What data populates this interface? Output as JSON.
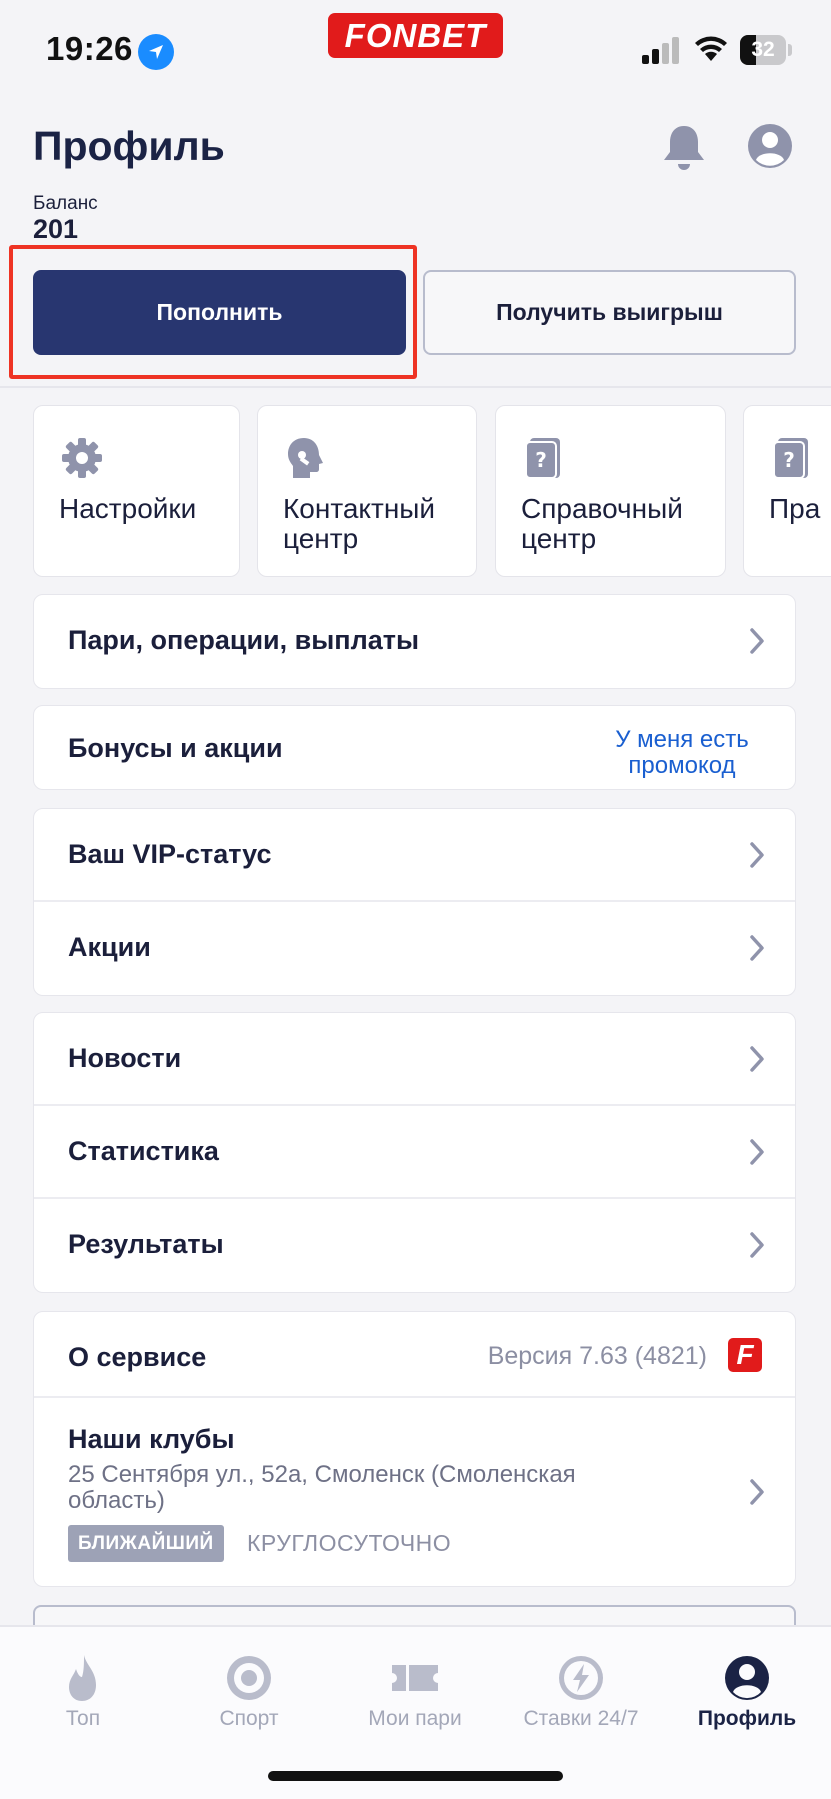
{
  "status_bar": {
    "time": "19:26",
    "brand": "FONBET",
    "battery": "32"
  },
  "header": {
    "title": "Профиль",
    "balance_label": "Баланс",
    "balance_value": "201"
  },
  "actions": {
    "deposit": "Пополнить",
    "withdraw": "Получить выигрыш"
  },
  "tiles": [
    {
      "label": "Настройки",
      "icon": "gear-icon"
    },
    {
      "label": "Контактный центр",
      "icon": "support-head-icon"
    },
    {
      "label": "Справочный центр",
      "icon": "help-book-icon"
    },
    {
      "label": "Пра",
      "icon": "rules-book-icon"
    }
  ],
  "menu": {
    "bets": "Пари, операции, выплаты",
    "bonuses": "Бонусы и акции",
    "promo_link": "У меня есть промокод",
    "vip": "Ваш VIP-статус",
    "promos": "Акции",
    "news": "Новости",
    "stats": "Статистика",
    "results": "Результаты",
    "about": "О сервисе",
    "version": "Версия 7.63 (4821)",
    "f_logo": "F"
  },
  "clubs": {
    "title": "Наши клубы",
    "address": "25 Сентября ул., 52а, Смоленск (Смоленская область)",
    "badge": "БЛИЖАЙШИЙ",
    "hours": "КРУГЛОСУТОЧНО"
  },
  "tabbar": [
    {
      "label": "Топ",
      "icon": "flame-icon"
    },
    {
      "label": "Спорт",
      "icon": "target-icon"
    },
    {
      "label": "Мои пари",
      "icon": "ticket-icon"
    },
    {
      "label": "Ставки 24/7",
      "icon": "lightning-icon"
    },
    {
      "label": "Профиль",
      "icon": "profile-icon",
      "active": true
    }
  ],
  "colors": {
    "primary": "#283670",
    "brand_red": "#e11b1b",
    "highlight": "#ee3324",
    "link": "#1a5fd0",
    "icon_gray": "#8f93ab"
  }
}
